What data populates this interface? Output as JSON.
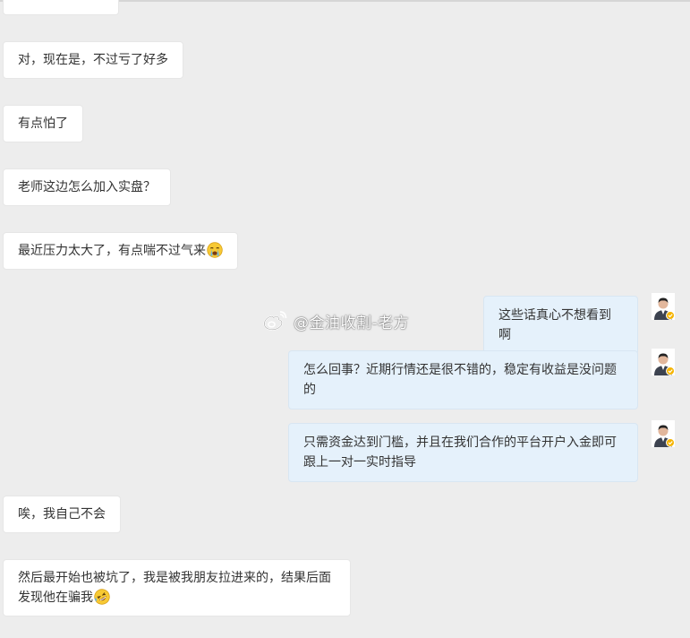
{
  "messages": [
    {
      "id": "m1",
      "side": "in",
      "text": "对，现在是，不过亏了好多"
    },
    {
      "id": "m2",
      "side": "in",
      "text": "有点怕了"
    },
    {
      "id": "m3",
      "side": "in",
      "text": "老师这边怎么加入实盘？"
    },
    {
      "id": "m4",
      "side": "in",
      "text": "最近压力太大了，有点喘不过气来",
      "emoji": "crying-face"
    },
    {
      "id": "m5",
      "side": "out",
      "text": "这些话真心不想看到啊"
    },
    {
      "id": "m6",
      "side": "out",
      "text": "怎么回事？近期行情还是很不错的，稳定有收益是没问题的"
    },
    {
      "id": "m7",
      "side": "out",
      "text": "只需资金达到门槛，并且在我们合作的平台开户入金即可跟上一对一实时指导"
    },
    {
      "id": "m8",
      "side": "in",
      "text": "唉，我自己不会"
    },
    {
      "id": "m9",
      "side": "in",
      "text": "然后最开始也被坑了，我是被我朋友拉进来的，结果后面发现他在骗我",
      "emoji": "rolling-laughing-face"
    }
  ],
  "watermark": {
    "icon": "weibo-icon",
    "text": "@金油收割-老方"
  },
  "colors": {
    "background": "#ededed",
    "incoming_bubble": "#ffffff",
    "outgoing_bubble": "#e5f1fb",
    "text": "#333333"
  }
}
